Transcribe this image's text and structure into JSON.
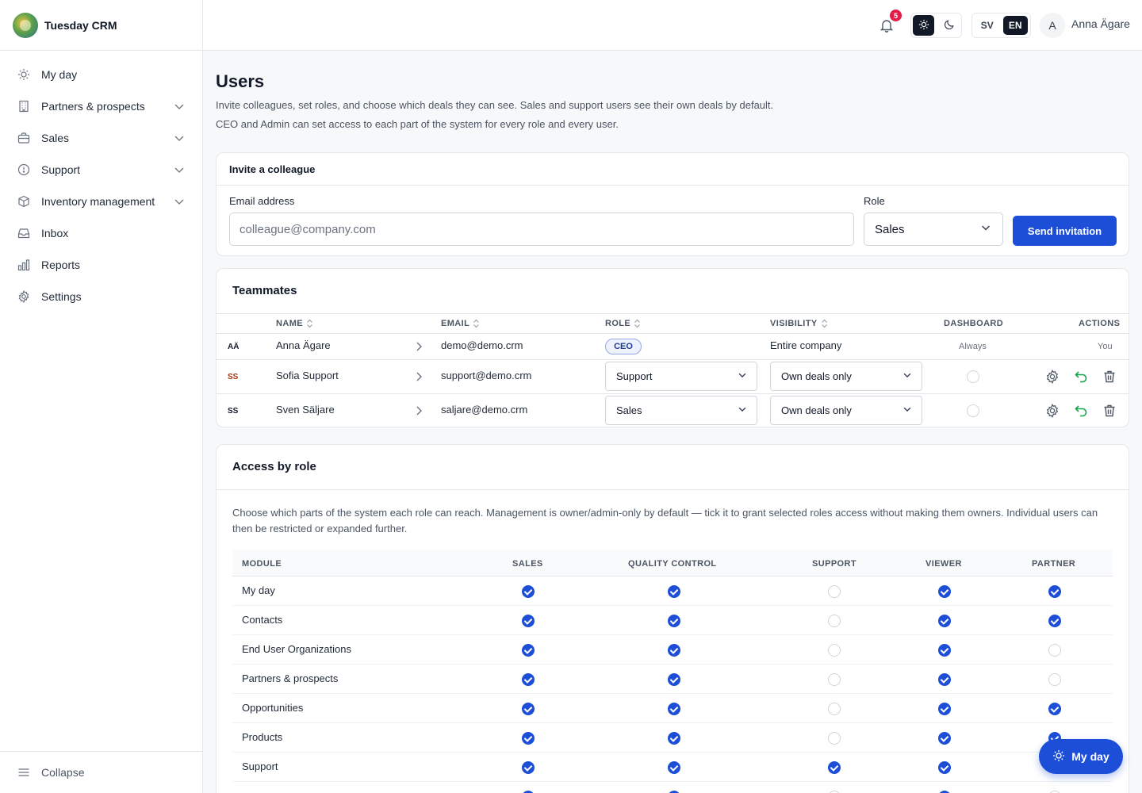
{
  "brand": {
    "name": "Tuesday CRM"
  },
  "sidebar": {
    "items": [
      {
        "label": "My day",
        "icon": "sun-icon",
        "expandable": false
      },
      {
        "label": "Partners & prospects",
        "icon": "building-icon",
        "expandable": true
      },
      {
        "label": "Sales",
        "icon": "briefcase-icon",
        "expandable": true
      },
      {
        "label": "Support",
        "icon": "support-icon",
        "expandable": true
      },
      {
        "label": "Inventory management",
        "icon": "box-icon",
        "expandable": true
      },
      {
        "label": "Inbox",
        "icon": "inbox-icon",
        "expandable": false
      },
      {
        "label": "Reports",
        "icon": "bar-chart-icon",
        "expandable": false
      },
      {
        "label": "Settings",
        "icon": "gear-icon",
        "expandable": false
      }
    ],
    "collapse_label": "Collapse"
  },
  "topbar": {
    "notification_count": "5",
    "lang": {
      "sv": "SV",
      "en": "EN",
      "active": "EN"
    },
    "theme_active": "light",
    "user_initial": "A",
    "user_name": "Anna Ägare"
  },
  "page": {
    "title": "Users",
    "desc1": "Invite colleagues, set roles, and choose which deals they can see. Sales and support users see their own deals by default.",
    "desc2": "CEO and Admin can set access to each part of the system for every role and every user."
  },
  "invite": {
    "title": "Invite a colleague",
    "email_label": "Email address",
    "email_placeholder": "colleague@company.com",
    "role_label": "Role",
    "role_value": "Sales",
    "send_label": "Send invitation"
  },
  "teammates": {
    "title": "Teammates",
    "headers": {
      "name": "NAME",
      "email": "EMAIL",
      "role": "ROLE",
      "visibility": "VISIBILITY",
      "dashboard": "DASHBOARD",
      "actions": "ACTIONS"
    },
    "rows": [
      {
        "initials": "AÄ",
        "initials_color": "#111827",
        "name": "Anna Ägare",
        "email": "demo@demo.crm",
        "role": "CEO",
        "visibility": "Entire company",
        "dashboard": "Always",
        "actions": "You"
      },
      {
        "initials": "SS",
        "initials_color": "#9a3412",
        "name": "Sofia Support",
        "email": "support@demo.crm",
        "role": "Support",
        "visibility": "Own deals only"
      },
      {
        "initials": "SS",
        "initials_color": "#111827",
        "name": "Sven Säljare",
        "email": "saljare@demo.crm",
        "role": "Sales",
        "visibility": "Own deals only"
      }
    ]
  },
  "access": {
    "title": "Access by role",
    "desc": "Choose which parts of the system each role can reach. Management is owner/admin-only by default — tick it to grant selected roles access without making them owners. Individual users can then be restricted or expanded further.",
    "headers": {
      "module": "MODULE",
      "sales": "SALES",
      "qc": "QUALITY CONTROL",
      "support": "SUPPORT",
      "viewer": "VIEWER",
      "partner": "PARTNER"
    },
    "rows": [
      {
        "module": "My day",
        "values": [
          true,
          true,
          false,
          true,
          true
        ]
      },
      {
        "module": "Contacts",
        "values": [
          true,
          true,
          false,
          true,
          true
        ]
      },
      {
        "module": "End User Organizations",
        "values": [
          true,
          true,
          false,
          true,
          false
        ]
      },
      {
        "module": "Partners & prospects",
        "values": [
          true,
          true,
          false,
          true,
          false
        ]
      },
      {
        "module": "Opportunities",
        "values": [
          true,
          true,
          false,
          true,
          true
        ]
      },
      {
        "module": "Products",
        "values": [
          true,
          true,
          false,
          true,
          true
        ]
      },
      {
        "module": "Support",
        "values": [
          true,
          true,
          true,
          true,
          false
        ]
      },
      {
        "module": "",
        "values": [
          true,
          true,
          false,
          true,
          false
        ]
      }
    ]
  },
  "fab": {
    "label": "My day"
  },
  "colors": {
    "accent": "#1d4ed8",
    "badge": "#e11d48",
    "undo": "#16a34a"
  }
}
